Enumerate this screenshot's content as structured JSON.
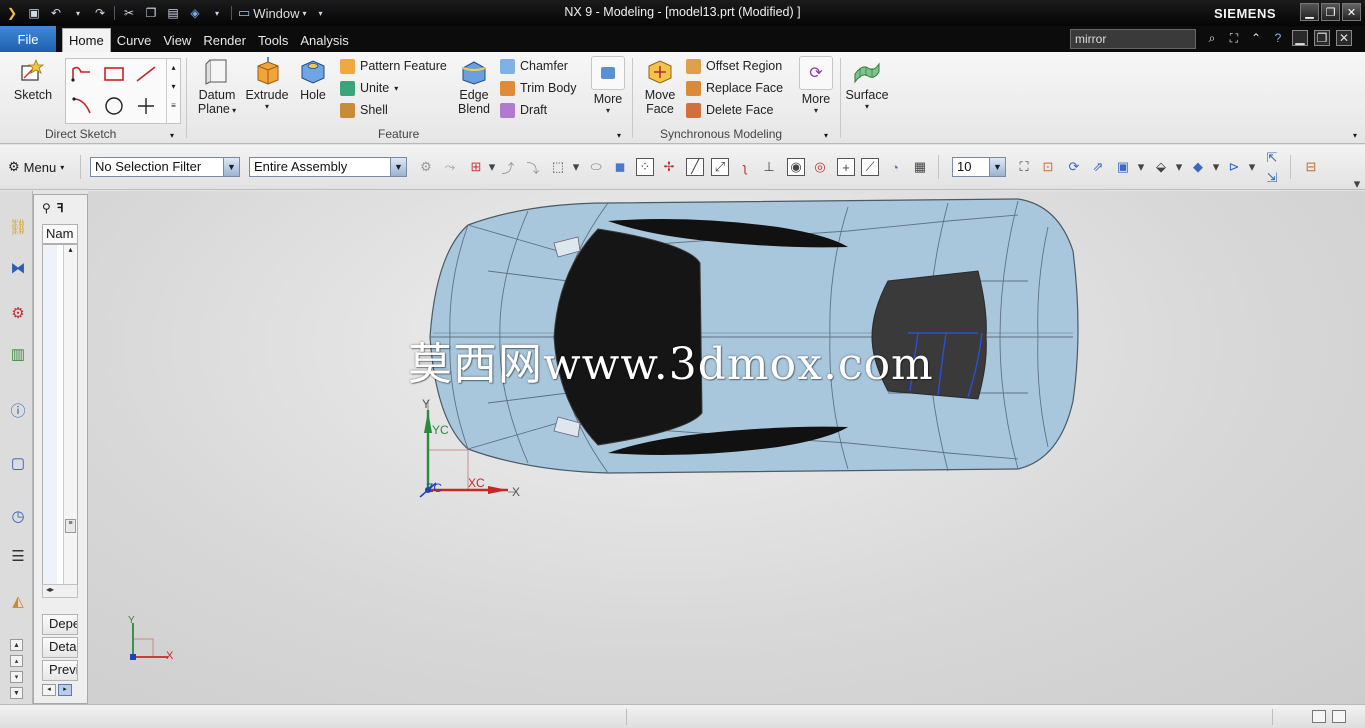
{
  "window": {
    "title": "NX 9 - Modeling - [model13.prt (Modified) ]",
    "brand": "SIEMENS",
    "window_menu_label": "Window"
  },
  "ribbon_tabs": {
    "file": "File",
    "tabs": [
      "Home",
      "Curve",
      "View",
      "Render",
      "Tools",
      "Analysis"
    ],
    "active": "Home"
  },
  "command_search": {
    "value": "mirror"
  },
  "ribbon": {
    "direct_sketch": {
      "label": "Direct Sketch",
      "sketch": "Sketch"
    },
    "feature": {
      "label": "Feature",
      "datum_plane_1": "Datum",
      "datum_plane_2": "Plane",
      "extrude": "Extrude",
      "hole": "Hole",
      "pattern_feature": "Pattern Feature",
      "unite": "Unite",
      "shell": "Shell",
      "edge_blend_1": "Edge",
      "edge_blend_2": "Blend",
      "chamfer": "Chamfer",
      "trim_body": "Trim Body",
      "draft": "Draft",
      "more": "More"
    },
    "synchronous": {
      "label": "Synchronous Modeling",
      "move_face_1": "Move",
      "move_face_2": "Face",
      "offset_region": "Offset Region",
      "replace_face": "Replace Face",
      "delete_face": "Delete Face",
      "more": "More"
    },
    "surface": {
      "label": "Surface"
    }
  },
  "selection_bar": {
    "menu": "Menu",
    "filter": "No Selection Filter",
    "scope": "Entire Assembly",
    "grid_value": "10"
  },
  "navigator": {
    "column_header": "Nam",
    "sections": [
      "Depe",
      "Deta",
      "Previ"
    ]
  },
  "graphics": {
    "watermark": "莫西网www.3dmox.com",
    "wcs_labels": {
      "y": "Y",
      "yc": "YC",
      "zc": "ZC",
      "xc": "XC",
      "x": "X"
    },
    "triad_labels": {
      "y": "Y",
      "x": "X"
    },
    "colors": {
      "car_body": "#a7c6dc",
      "glass": "#1a1a1a",
      "wcs_y": "#2b8a3e",
      "wcs_x": "#c62828",
      "wcs_z": "#1e3fbf"
    }
  }
}
